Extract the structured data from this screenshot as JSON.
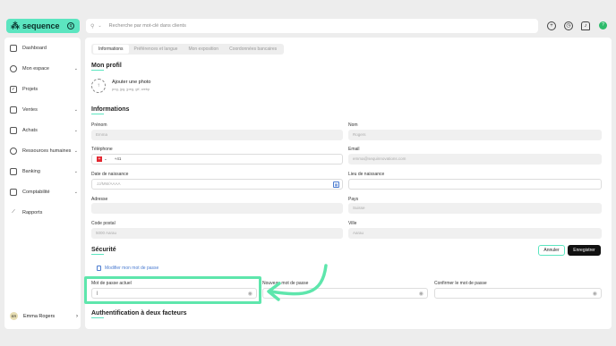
{
  "app": {
    "brand": "sequence",
    "brand_mark": "⁂",
    "badge_icon": "q"
  },
  "search": {
    "placeholder": "Recherche par mot-clé dans clients",
    "icon": "search-icon",
    "scope": "⌄"
  },
  "top_icons": [
    "plus-circle-icon",
    "clock-icon",
    "bell-icon",
    "question-icon"
  ],
  "top_avatar": "?",
  "sidebar": {
    "items": [
      {
        "label": "Dashboard",
        "icon": "home-icon",
        "chevron": ""
      },
      {
        "label": "Mon espace",
        "icon": "user-icon",
        "chevron": "⌄"
      },
      {
        "label": "Projets",
        "icon": "check-icon",
        "chevron": ""
      },
      {
        "label": "Ventes",
        "icon": "tag-icon",
        "chevron": "⌄"
      },
      {
        "label": "Achats",
        "icon": "bag-icon",
        "chevron": "⌄"
      },
      {
        "label": "Ressources humaines",
        "icon": "people-icon",
        "chevron": "⌄"
      },
      {
        "label": "Banking",
        "icon": "bank-icon",
        "chevron": "⌄"
      },
      {
        "label": "Comptabilité",
        "icon": "ledger-icon",
        "chevron": "⌄"
      },
      {
        "label": "Rapports",
        "icon": "chart-icon",
        "chevron": ""
      }
    ],
    "user": {
      "initials": "ER",
      "name": "Emma Rogers",
      "chevron": "›"
    }
  },
  "tabs": [
    {
      "label": "Informations",
      "active": true
    },
    {
      "label": "Préférences et langue",
      "active": false
    },
    {
      "label": "Mon exposition",
      "active": false
    },
    {
      "label": "Coordonnées bancaires",
      "active": false
    }
  ],
  "profile": {
    "title": "Mon profil",
    "photo_label": "Ajouter une photo",
    "photo_hint": "png, jpg, jpeg, gif, webp"
  },
  "info": {
    "title": "Informations",
    "prenom_label": "Prénom",
    "prenom_value": "Emma",
    "nom_label": "Nom",
    "nom_value": "Rogers",
    "tel_label": "Téléphone",
    "tel_prefix": "+41",
    "tel_flag": "+",
    "email_label": "Email",
    "email_value": "emma@sequinnovations.com",
    "dob_label": "Date de naissance",
    "dob_placeholder": "JJ/MM/AAAA",
    "lieu_label": "Lieu de naissance",
    "adresse_label": "Adresse",
    "pays_label": "Pays",
    "pays_value": "Suisse",
    "cp_label": "Code postal",
    "cp_value": "5000 Aarau",
    "ville_label": "Ville",
    "ville_value": "Aarau"
  },
  "security": {
    "title": "Sécurité",
    "cancel": "Annuler",
    "save": "Enregistrer",
    "change_pwd": "Modifier mon mot de passe",
    "current_label": "Mot de passe actuel",
    "new_label": "Nouveau mot de passe",
    "confirm_label": "Confirmer le mot de passe",
    "current_value": "|"
  },
  "twofa": {
    "title": "Authentification à deux facteurs"
  },
  "colors": {
    "accent": "#5ce5c0",
    "highlight": "#5ee6ac",
    "link": "#4a7bd0"
  }
}
